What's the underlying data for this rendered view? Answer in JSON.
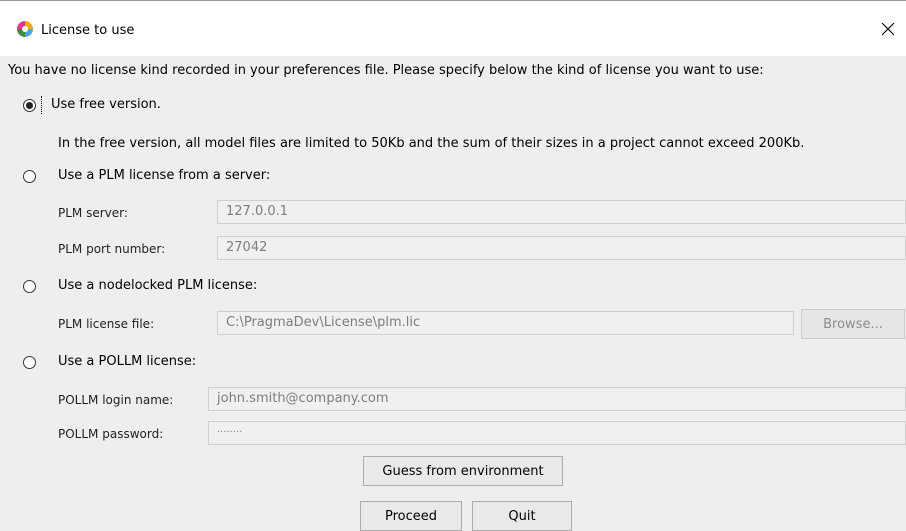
{
  "window": {
    "title": "License to use",
    "close_symbol": "✕",
    "icon": "app-logo-icon"
  },
  "intro": "You have no license kind recorded in your preferences file. Please specify below the kind of license you want to use:",
  "options": {
    "free": {
      "label": "Use free version.",
      "selected": true,
      "note": "In the free version, all model files are limited to 50Kb and the sum of their sizes in a project cannot exceed 200Kb."
    },
    "server": {
      "label": "Use a PLM license from a server:",
      "selected": false,
      "server_label": "PLM server:",
      "server_value": "127.0.0.1",
      "port_label": "PLM port number:",
      "port_value": "27042"
    },
    "nodelocked": {
      "label": "Use a nodelocked PLM license:",
      "selected": false,
      "file_label": "PLM license file:",
      "file_value": "C:\\PragmaDev\\License\\plm.lic",
      "browse_label": "Browse..."
    },
    "pollm": {
      "label": "Use a POLLM license:",
      "selected": false,
      "login_label": "POLLM login name:",
      "login_value": "john.smith@company.com",
      "password_label": "POLLM password:",
      "password_value": "········"
    }
  },
  "buttons": {
    "guess": "Guess from environment",
    "proceed": "Proceed",
    "quit": "Quit"
  }
}
